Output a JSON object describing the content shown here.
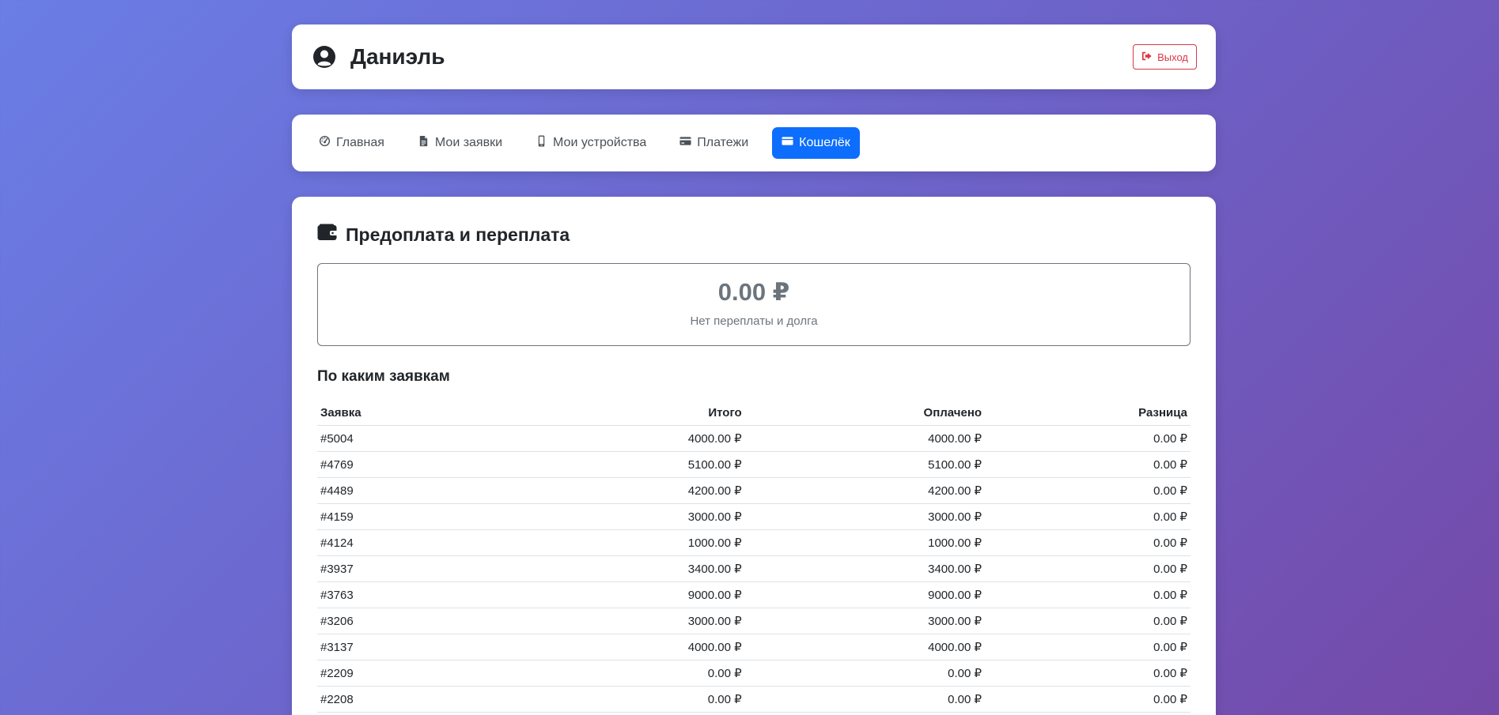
{
  "header": {
    "user_name": "Даниэль",
    "logout_label": "Выход"
  },
  "nav": {
    "items": [
      {
        "label": "Главная",
        "icon": "dashboard-icon"
      },
      {
        "label": "Мои заявки",
        "icon": "file-icon"
      },
      {
        "label": "Мои устройства",
        "icon": "mobile-icon"
      },
      {
        "label": "Платежи",
        "icon": "credit-card-icon"
      },
      {
        "label": "Кошелёк",
        "icon": "wallet-card-icon",
        "active": true
      }
    ]
  },
  "wallet": {
    "title": "Предоплата и переплата",
    "balance": "0.00 ₽",
    "status": "Нет переплаты и долга",
    "orders_title": "По каким заявкам"
  },
  "table": {
    "headers": [
      "Заявка",
      "Итого",
      "Оплачено",
      "Разница"
    ],
    "rows": [
      [
        "#5004",
        "4000.00 ₽",
        "4000.00 ₽",
        "0.00 ₽"
      ],
      [
        "#4769",
        "5100.00 ₽",
        "5100.00 ₽",
        "0.00 ₽"
      ],
      [
        "#4489",
        "4200.00 ₽",
        "4200.00 ₽",
        "0.00 ₽"
      ],
      [
        "#4159",
        "3000.00 ₽",
        "3000.00 ₽",
        "0.00 ₽"
      ],
      [
        "#4124",
        "1000.00 ₽",
        "1000.00 ₽",
        "0.00 ₽"
      ],
      [
        "#3937",
        "3400.00 ₽",
        "3400.00 ₽",
        "0.00 ₽"
      ],
      [
        "#3763",
        "9000.00 ₽",
        "9000.00 ₽",
        "0.00 ₽"
      ],
      [
        "#3206",
        "3000.00 ₽",
        "3000.00 ₽",
        "0.00 ₽"
      ],
      [
        "#3137",
        "4000.00 ₽",
        "4000.00 ₽",
        "0.00 ₽"
      ],
      [
        "#2209",
        "0.00 ₽",
        "0.00 ₽",
        "0.00 ₽"
      ],
      [
        "#2208",
        "0.00 ₽",
        "0.00 ₽",
        "0.00 ₽"
      ]
    ]
  },
  "colors": {
    "accent": "#0d6efd",
    "danger": "#dc3545",
    "muted": "#6c757d"
  }
}
